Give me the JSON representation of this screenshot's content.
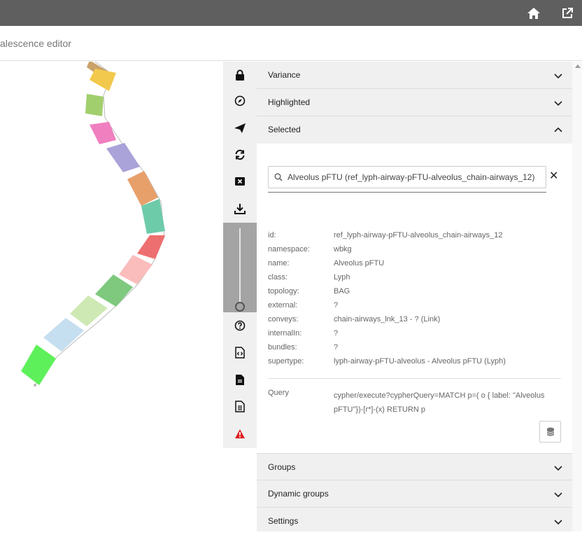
{
  "app": {
    "title": "alescence editor",
    "home_icon": "home-icon",
    "open_external_icon": "open-external-icon"
  },
  "toolbar": {
    "tools": [
      "lock-icon",
      "compass-icon",
      "send-icon",
      "refresh-icon",
      "close-box-icon",
      "download-icon",
      "help-icon",
      "code-file-icon",
      "file-icon",
      "document-icon",
      "warning-icon"
    ]
  },
  "panel": {
    "sections": {
      "variance": "Variance",
      "highlighted": "Highlighted",
      "selected": "Selected",
      "groups": "Groups",
      "dynamic_groups": "Dynamic groups",
      "settings": "Settings"
    },
    "search": {
      "value": "Alveolus pFTU (ref_lyph-airway-pFTU-alveolus_chain-airways_12)",
      "clear": "✕"
    },
    "properties": [
      {
        "key": "id:",
        "value": "ref_lyph-airway-pFTU-alveolus_chain-airways_12"
      },
      {
        "key": "namespace:",
        "value": "wbkg"
      },
      {
        "key": "name:",
        "value": "Alveolus pFTU"
      },
      {
        "key": "class:",
        "value": "Lyph"
      },
      {
        "key": "topology:",
        "value": "BAG"
      },
      {
        "key": "external:",
        "value": "?"
      },
      {
        "key": "conveys:",
        "value": "chain-airways_lnk_13 - ? (Link)"
      },
      {
        "key": "internalIn:",
        "value": "?"
      },
      {
        "key": "bundles:",
        "value": "?"
      },
      {
        "key": "supertype:",
        "value": "lyph-airway-pFTU-alveolus - Alveolus pFTU (Lyph)"
      }
    ],
    "query": {
      "key": "Query",
      "value": "cypher/execute?cypherQuery=MATCH p=( o { label: \"Alveolus pFTU\"})-[r*]-(x) RETURN p"
    }
  },
  "colors": {
    "topbar": "#5f5f5f",
    "toolbar": "#f0f0f0",
    "slider": "#a4a4a4",
    "warning": "#e02020",
    "lyphs": [
      "#c9a36a",
      "#f2c94c",
      "#a2cf6e",
      "#f07fbf",
      "#a9a3d9",
      "#e8a06a",
      "#6ecbaa",
      "#ee6f6f",
      "#fbbcbc",
      "#7ec97e",
      "#cfe9b4",
      "#c6dff0",
      "#5ef05a"
    ]
  }
}
